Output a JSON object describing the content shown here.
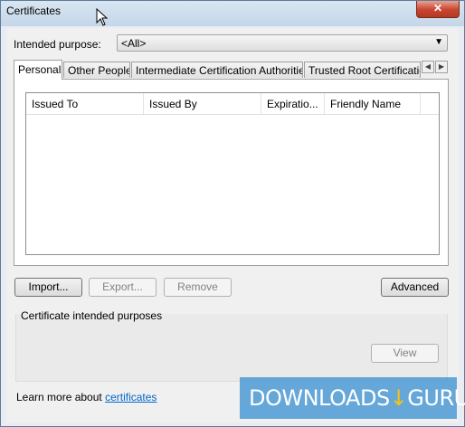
{
  "window": {
    "title": "Certificates",
    "close_glyph": "✕"
  },
  "purpose": {
    "label": "Intended purpose:",
    "value": "<All>",
    "dropdown_icon": "chevron-down-icon"
  },
  "tabs": [
    {
      "label": "Personal",
      "active": true
    },
    {
      "label": "Other People",
      "active": false
    },
    {
      "label": "Intermediate Certification Authorities",
      "active": false
    },
    {
      "label": "Trusted Root Certification Authorities",
      "active": false
    }
  ],
  "tab_scroll": {
    "left": "◀",
    "right": "▶"
  },
  "columns": [
    "Issued To",
    "Issued By",
    "Expiratio...",
    "Friendly Name"
  ],
  "rows": [],
  "buttons": {
    "import": "Import...",
    "export": "Export...",
    "remove": "Remove",
    "advanced": "Advanced",
    "view": "View"
  },
  "purposes_group": {
    "label": "Certificate intended purposes"
  },
  "learn_more": {
    "prefix": "Learn more about ",
    "link": "certificates"
  },
  "watermark": {
    "text": "DOWNLOADS",
    "suffix": "GURU"
  },
  "colors": {
    "link": "#0066cc",
    "close": "#c8442e",
    "banner": "#4696d2"
  }
}
